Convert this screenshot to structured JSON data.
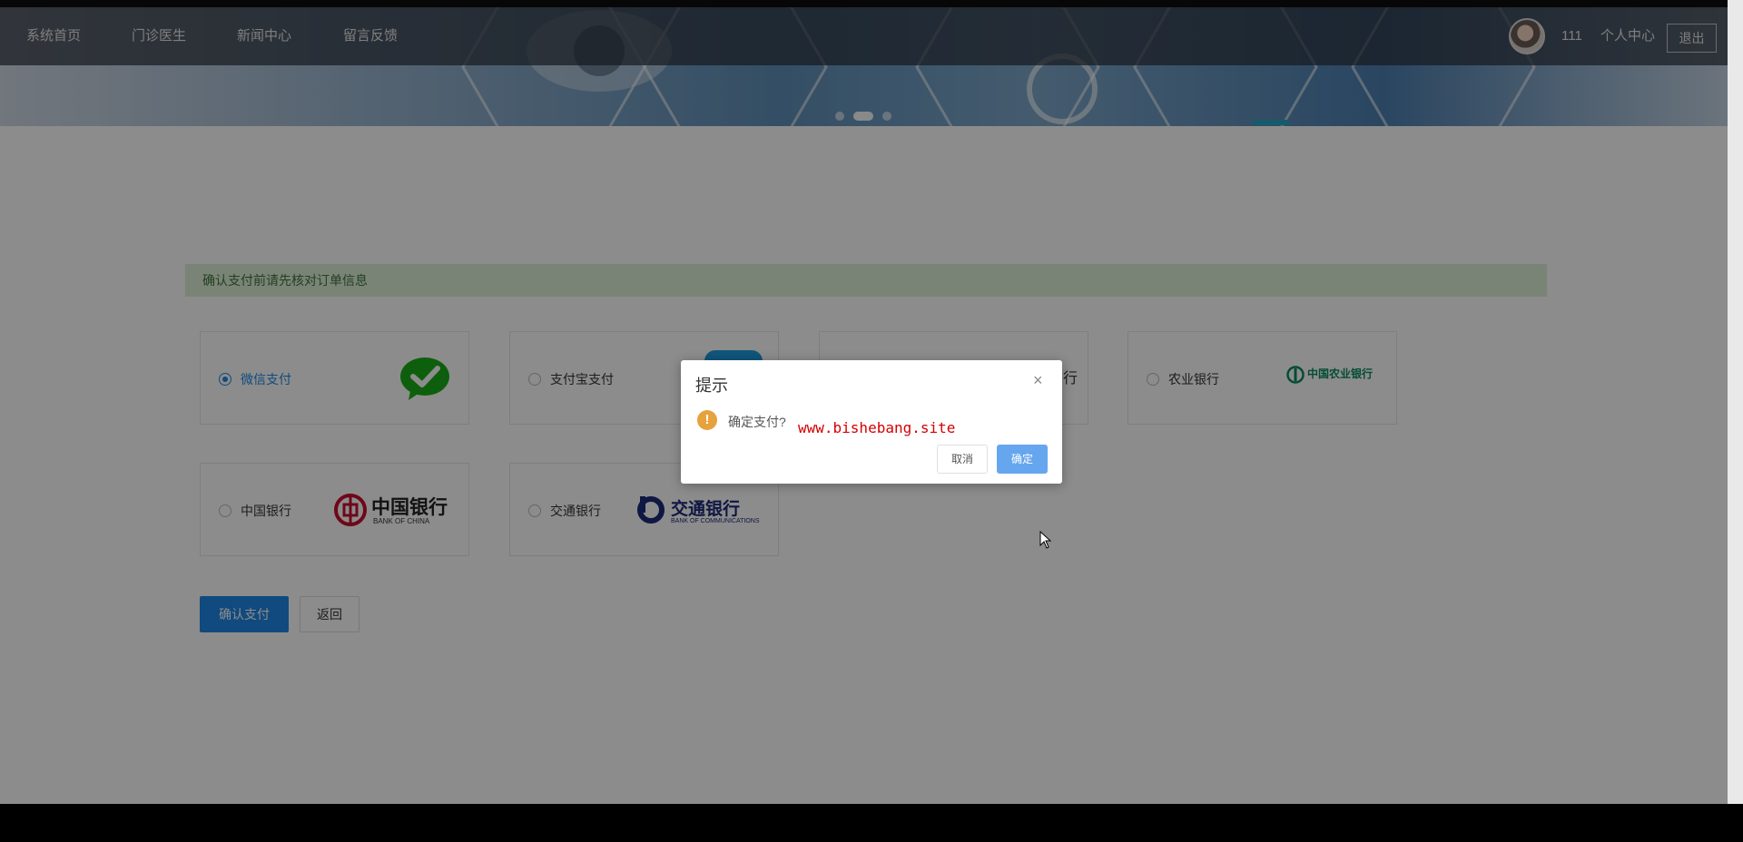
{
  "nav": {
    "items": [
      "系统首页",
      "门诊医生",
      "新闻中心",
      "留言反馈"
    ],
    "user_name": "111",
    "personal_center": "个人中心",
    "logout": "退出"
  },
  "notice": "确认支付前请先核对订单信息",
  "payment_methods": [
    {
      "label": "微信支付",
      "selected": true,
      "logo": "wechat-pay-icon"
    },
    {
      "label": "支付宝支付",
      "selected": false,
      "logo": "alipay-icon"
    },
    {
      "label": "",
      "selected": false,
      "logo": "bank-logo"
    },
    {
      "label": "农业银行",
      "selected": false,
      "logo": "agricultural-bank-logo"
    },
    {
      "label": "中国银行",
      "selected": false,
      "logo": "bank-of-china-logo"
    },
    {
      "label": "交通银行",
      "selected": false,
      "logo": "bank-of-communications-logo"
    }
  ],
  "logos": {
    "abc_cn": "中国农业银行",
    "boc_cn": "中国银行",
    "boc_en": "BANK OF CHINA",
    "bocom_cn": "交通银行",
    "bocom_en": "BANK OF COMMUNICATIONS",
    "blur_bank": "行"
  },
  "buttons": {
    "confirm": "确认支付",
    "back": "返回"
  },
  "dialog": {
    "title": "提示",
    "message": "确定支付?",
    "cancel": "取消",
    "ok": "确定",
    "close": "×",
    "icon": "!"
  },
  "watermark": "www.bishebang.site",
  "colors": {
    "primary": "#1e88e5",
    "notice_bg": "#dff0d8",
    "warning": "#e6a23c",
    "watermark": "#d40000"
  }
}
